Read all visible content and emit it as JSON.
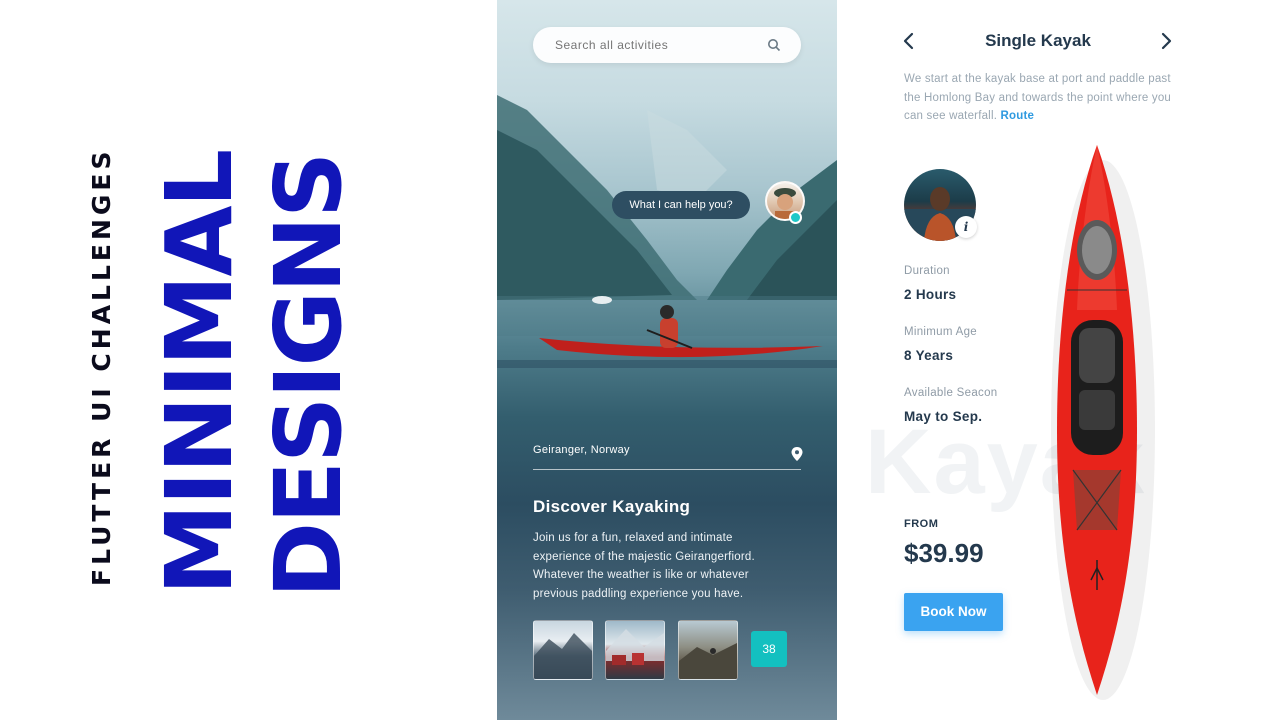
{
  "left_titles": {
    "subtitle": "FLUTTER UI CHALLENGES",
    "line1": "MINIMAL",
    "line2": "DESIGNS"
  },
  "phone1": {
    "search": {
      "placeholder": "Search all activities"
    },
    "help_bubble": "What I can help you?",
    "location": "Geiranger, Norway",
    "title": "Discover Kayaking",
    "body": "Join us for a fun, relaxed and intimate experience of the majestic Geirangerfiord. Whatever the weather is like or whatever previous paddling experience you have.",
    "more_count": "38"
  },
  "phone2": {
    "title": "Single Kayak",
    "description": "We start at the kayak base at port and paddle past the Homlong Bay and towards the point where you can see waterfall.",
    "route_link": "Route",
    "info_badge": "i",
    "watermark": "Kayak",
    "details": [
      {
        "label": "Duration",
        "value": "2 Hours"
      },
      {
        "label": "Minimum Age",
        "value": "8 Years"
      },
      {
        "label": "Available Seacon",
        "value": "May to Sep."
      }
    ],
    "from_label": "FROM",
    "price": "$39.99",
    "book_button": "Book Now"
  },
  "colors": {
    "brand_blue": "#1116b8",
    "accent_teal": "#13c0c0",
    "button_blue": "#3aa3f0",
    "kayak_red": "#e8231b",
    "dark_text": "#24394d"
  }
}
